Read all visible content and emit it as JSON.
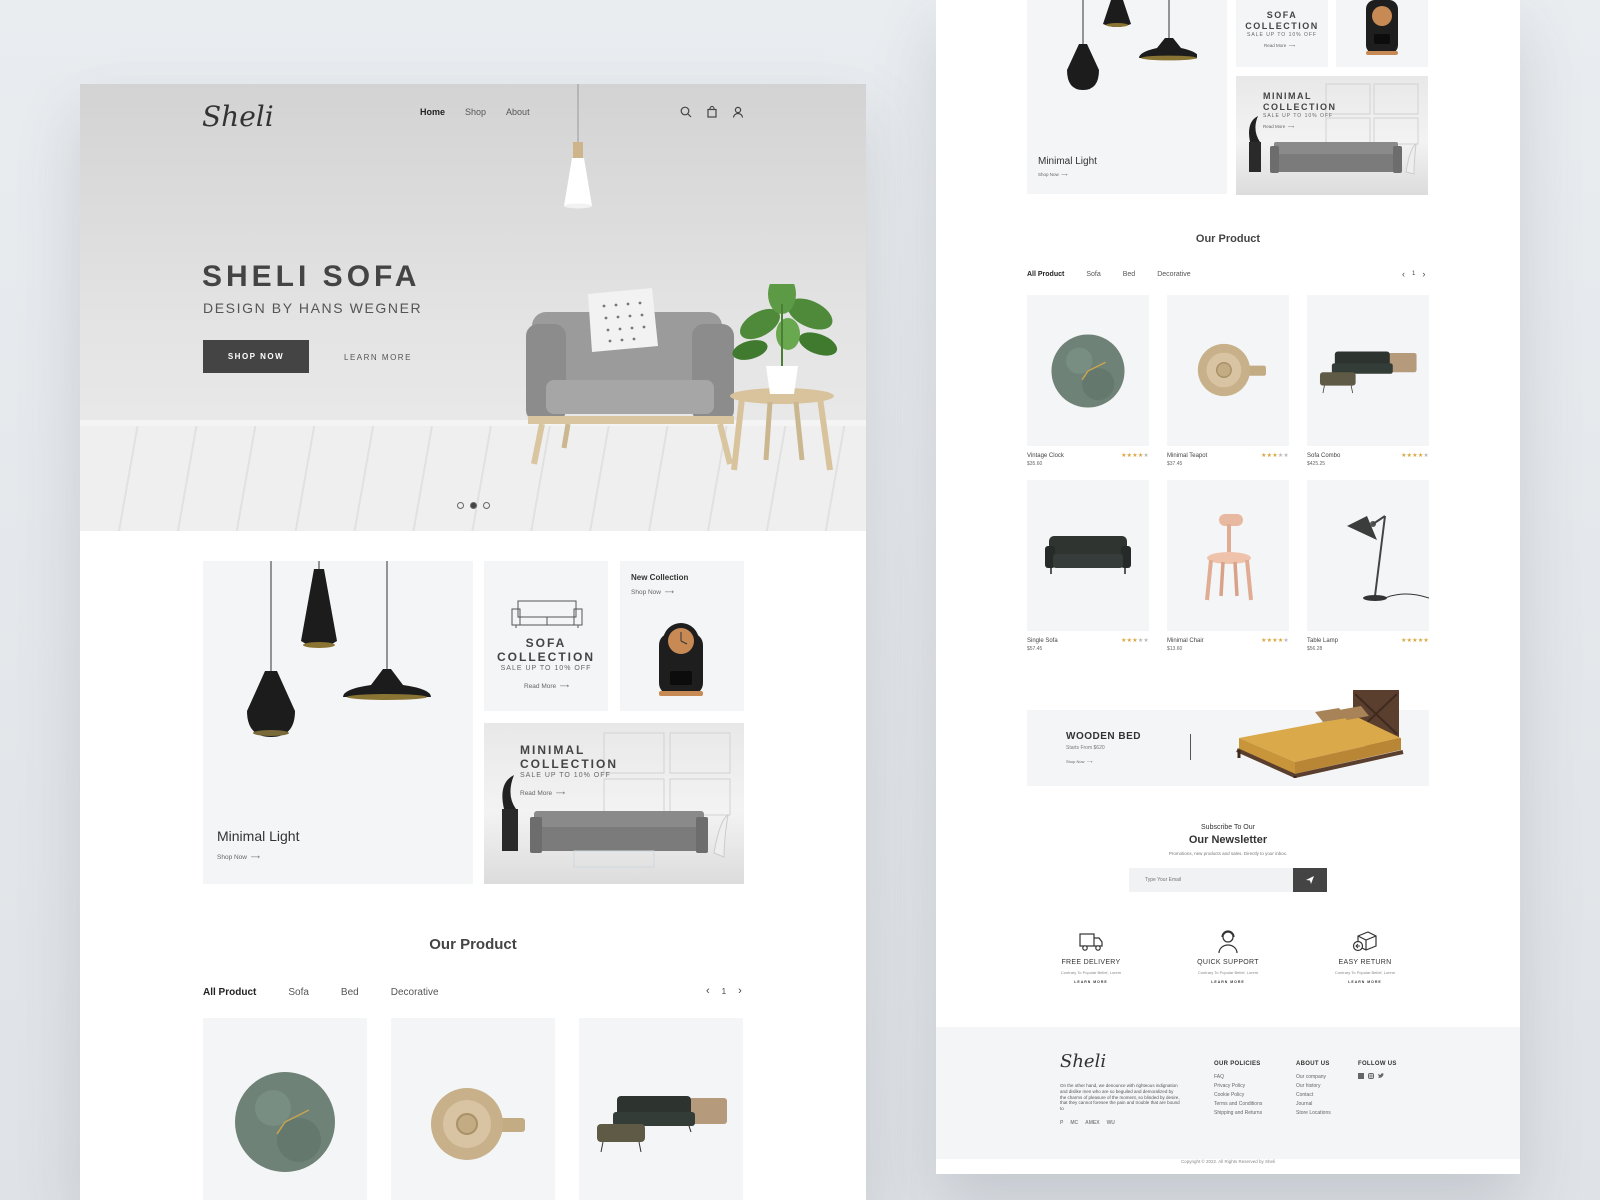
{
  "brand": {
    "logo": "Sheli"
  },
  "nav": {
    "home": "Home",
    "shop": "Shop",
    "about": "About"
  },
  "hero": {
    "title": "SHELI SOFA",
    "subtitle": "DESIGN BY HANS WEGNER",
    "shop_now": "SHOP NOW",
    "learn_more": "LEARN MORE",
    "slides": 3,
    "active_slide": 2
  },
  "collections": {
    "minimal_light": {
      "title": "Minimal Light",
      "link": "Shop Now"
    },
    "sofa": {
      "title_line1": "SOFA",
      "title_line2": "COLLECTION",
      "sale": "SALE UP TO 10% OFF",
      "link": "Read More"
    },
    "new_collection": {
      "title": "New Collection",
      "link": "Shop Now"
    },
    "minimal": {
      "title_line1": "MINIMAL",
      "title_line2": "COLLECTION",
      "sale": "SALE UP TO 10% OFF",
      "link": "Read More"
    }
  },
  "products_section": {
    "title": "Our Product",
    "filters": [
      "All Product",
      "Sofa",
      "Bed",
      "Decorative"
    ],
    "page": "1"
  },
  "products": [
    {
      "name": "Vintage Clock",
      "price": "$35.60",
      "rating": 4
    },
    {
      "name": "Minimal Teapot",
      "price": "$37.45",
      "rating": 3
    },
    {
      "name": "Sofa Combo",
      "price": "$425.25",
      "rating": 4
    },
    {
      "name": "Single Sofa",
      "price": "$57.45",
      "rating": 3
    },
    {
      "name": "Minimal Chair",
      "price": "$13.60",
      "rating": 4
    },
    {
      "name": "Table Lamp",
      "price": "$56.28",
      "rating": 5
    }
  ],
  "banner": {
    "title": "WOODEN BED",
    "sub": "Starts From $620",
    "link": "Shop Now"
  },
  "newsletter": {
    "pre": "Subscribe To Our",
    "title": "Our Newsletter",
    "desc": "Promotions, new products and sales. Directly to your inbox.",
    "placeholder": "Type Your Email"
  },
  "features": [
    {
      "title": "FREE DELIVERY",
      "desc": "Contrary To Popular Belief, Lorem",
      "link": "LEARN MORE"
    },
    {
      "title": "QUICK SUPPORT",
      "desc": "Contrary To Popular Belief, Lorem",
      "link": "LEARN MORE"
    },
    {
      "title": "EASY RETURN",
      "desc": "Contrary To Popular Belief, Lorem",
      "link": "LEARN MORE"
    }
  ],
  "footer": {
    "about_text": "On the other hand, we denounce with righteous indignation and dislike men who are so beguiled and demoralized by the charms of pleasure of the moment, so blinded by desire, that they cannot foresee the pain and trouble that are bound to",
    "policies": {
      "title": "OUR POLICIES",
      "items": [
        "FAQ",
        "Privacy Policy",
        "Cookie Policy",
        "Terms and Conditions",
        "Shipping and Returns"
      ]
    },
    "about": {
      "title": "ABOUT US",
      "items": [
        "Our company",
        "Our history",
        "Contact",
        "Journal",
        "Store Locations"
      ]
    },
    "follow": {
      "title": "FOLLOW US"
    },
    "payments": [
      "P",
      "MC",
      "AMEX",
      "WU"
    ],
    "copyright": "Copyright © 2022. All Rights Reserved by Sheli"
  }
}
